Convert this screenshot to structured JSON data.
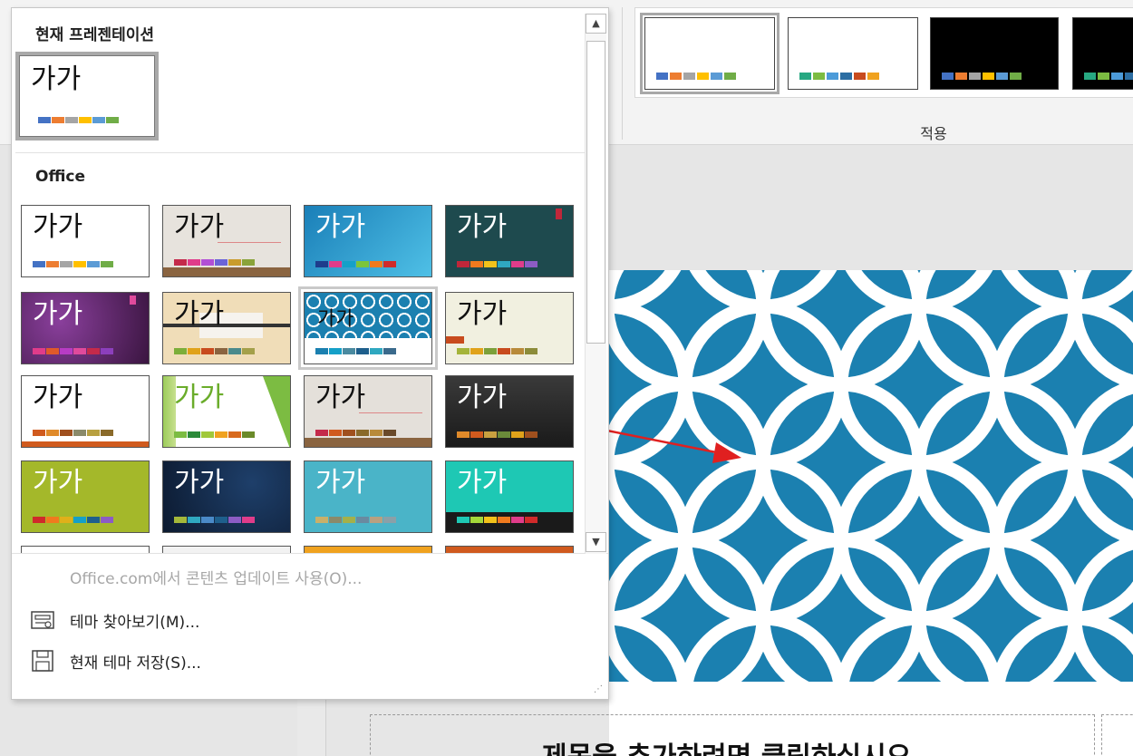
{
  "ribbon": {
    "group_label": "적용"
  },
  "panel": {
    "current_section_header": "현재 프레젠테이션",
    "office_section_header": "Office",
    "thumb_text": "가가",
    "menu": [
      {
        "label": "Office.com에서 콘텐츠 업데이트 사용(O)...",
        "enabled": false
      },
      {
        "label": "테마 찾아보기(M)...",
        "enabled": true
      },
      {
        "label": "현재 테마 저장(S)...",
        "enabled": true
      }
    ]
  },
  "slide": {
    "title_text": "제목을 추가하려면 클릭하십시오"
  },
  "colors": {
    "accent_arrow": "#e02020",
    "slide_pattern_bg": "#1b80b0"
  }
}
